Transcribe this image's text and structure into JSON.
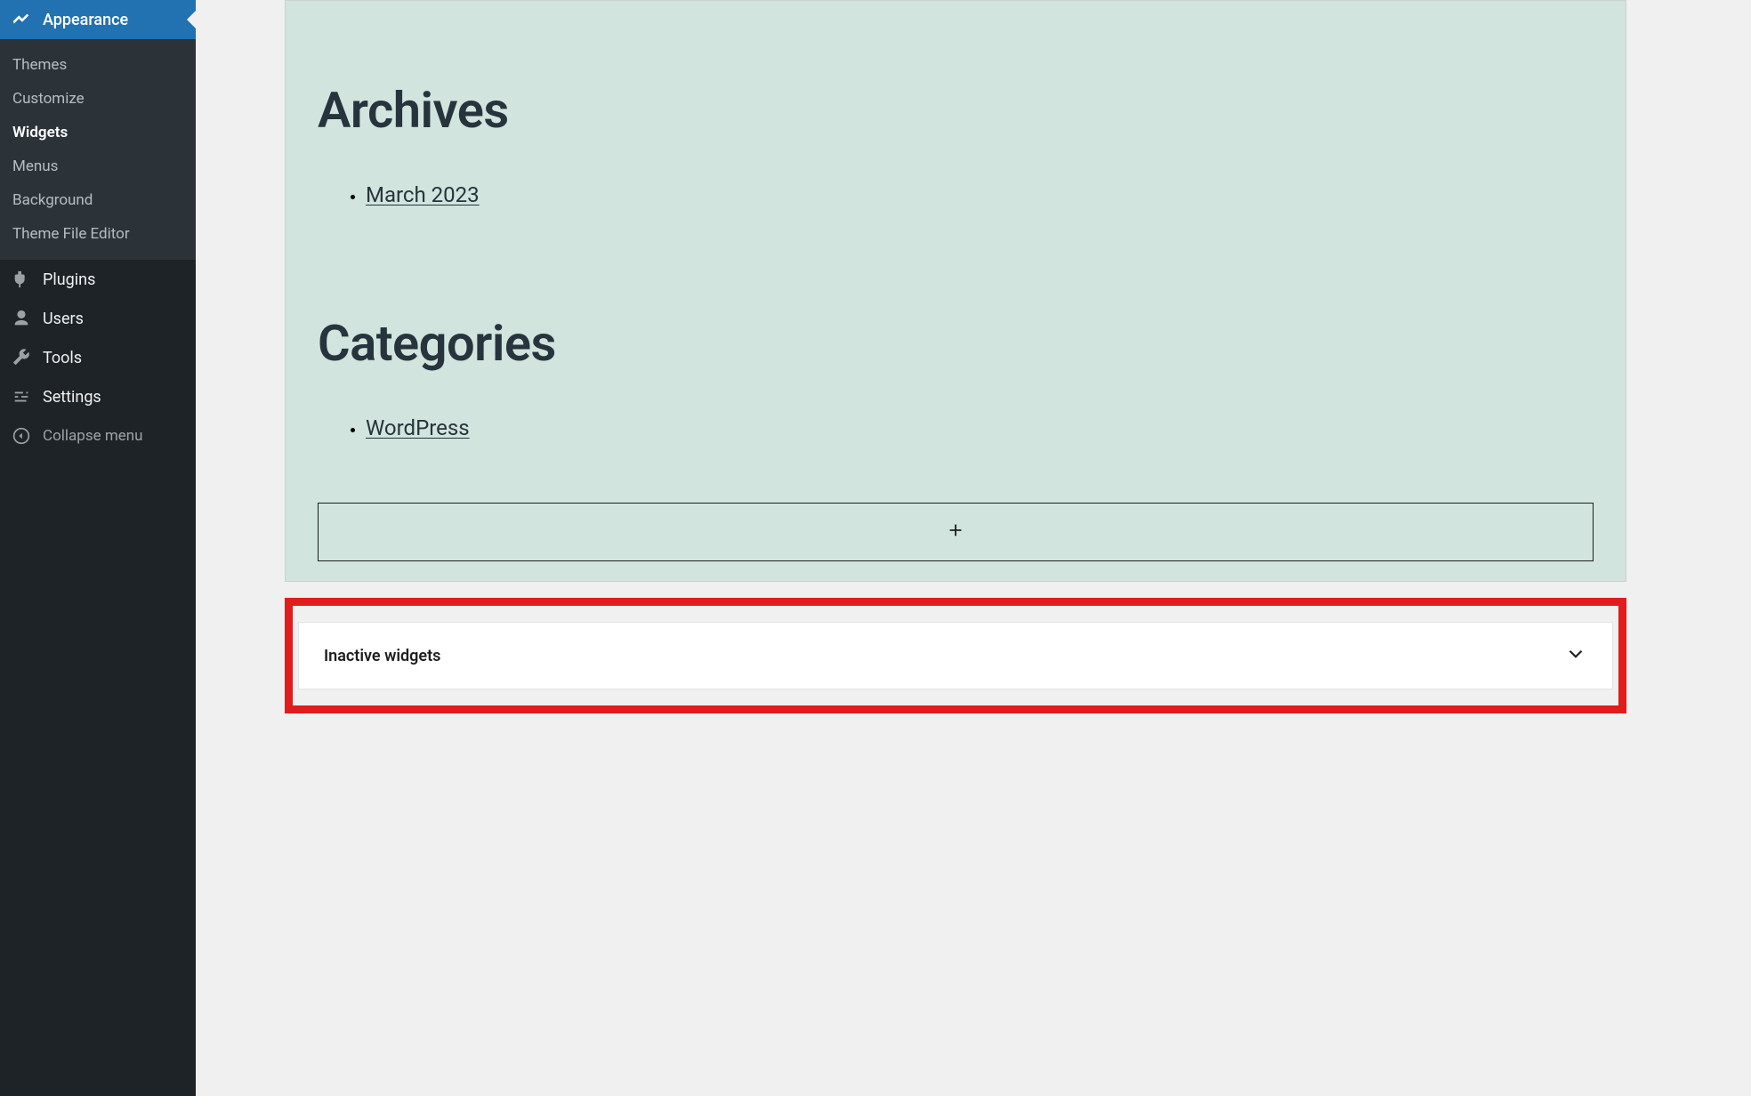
{
  "sidebar": {
    "active": {
      "label": "Appearance"
    },
    "submenu": {
      "themes": "Themes",
      "customize": "Customize",
      "widgets": "Widgets",
      "menus": "Menus",
      "background": "Background",
      "theme_file_editor": "Theme File Editor"
    },
    "plugins": "Plugins",
    "users": "Users",
    "tools": "Tools",
    "settings": "Settings",
    "collapse": "Collapse menu"
  },
  "widgets": {
    "archives": {
      "heading": "Archives",
      "items": [
        "March 2023"
      ]
    },
    "categories": {
      "heading": "Categories",
      "items": [
        "WordPress"
      ]
    }
  },
  "inactive": {
    "label": "Inactive widgets"
  }
}
